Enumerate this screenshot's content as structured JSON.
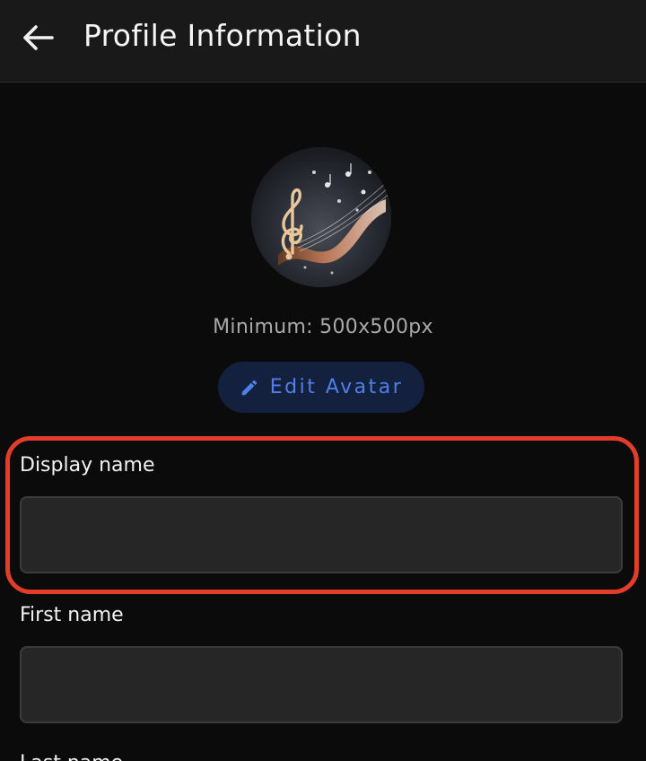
{
  "header": {
    "title": "Profile Information",
    "back_icon": "arrow-left-icon"
  },
  "avatar": {
    "icon": "music-treble-clef-image",
    "min_text": "Minimum: 500x500px",
    "edit_label": "Edit Avatar",
    "edit_icon": "pencil-icon"
  },
  "fields": {
    "display_name": {
      "label": "Display name",
      "value": ""
    },
    "first_name": {
      "label": "First name",
      "value": ""
    },
    "last_name": {
      "label": "Last name",
      "value": ""
    }
  },
  "colors": {
    "background": "#0b0b0b",
    "header": "#191919",
    "input_bg": "#262626",
    "accent": "#4f7fe8",
    "button_bg": "#14213e",
    "highlight": "#e23c2c"
  }
}
